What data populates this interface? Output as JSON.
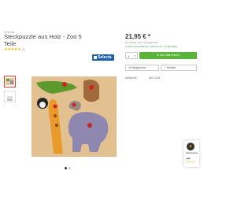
{
  "product": {
    "brand_small": "Selecta",
    "title": "Steckpuzzle aus Holz - Zoo 5 Teile",
    "stars": "★★★★★",
    "rating_count": "(1)",
    "brand_logo": "Selecta",
    "thumb_label": "Video"
  },
  "buybox": {
    "price": "21,95 € *",
    "price_note": "inkl. MwSt. zzgl. Versandkosten",
    "stock": "● Sofort versandfertig, Lieferzeit ca. 1-3 Werktage",
    "quantity": "1",
    "cart_label": "In den Warenkorb",
    "compare_label": "Vergleichen",
    "remember_label": "Merken",
    "article_no_label": "Artikel-Nr.:",
    "article_no_value": "SEL1234"
  },
  "trust_badge": {
    "seal": "e",
    "line1": "Käuferschutz",
    "score": "4,90",
    "stars": "★★★★★"
  },
  "colors": {
    "accent_green": "#59b43a",
    "brand_blue": "#1d5fa8",
    "star_yellow": "#f3b400"
  },
  "icons": [
    "scales-icon",
    "heart-icon",
    "chevron-down-icon",
    "play-icon",
    "trusted-shops-seal-icon"
  ]
}
